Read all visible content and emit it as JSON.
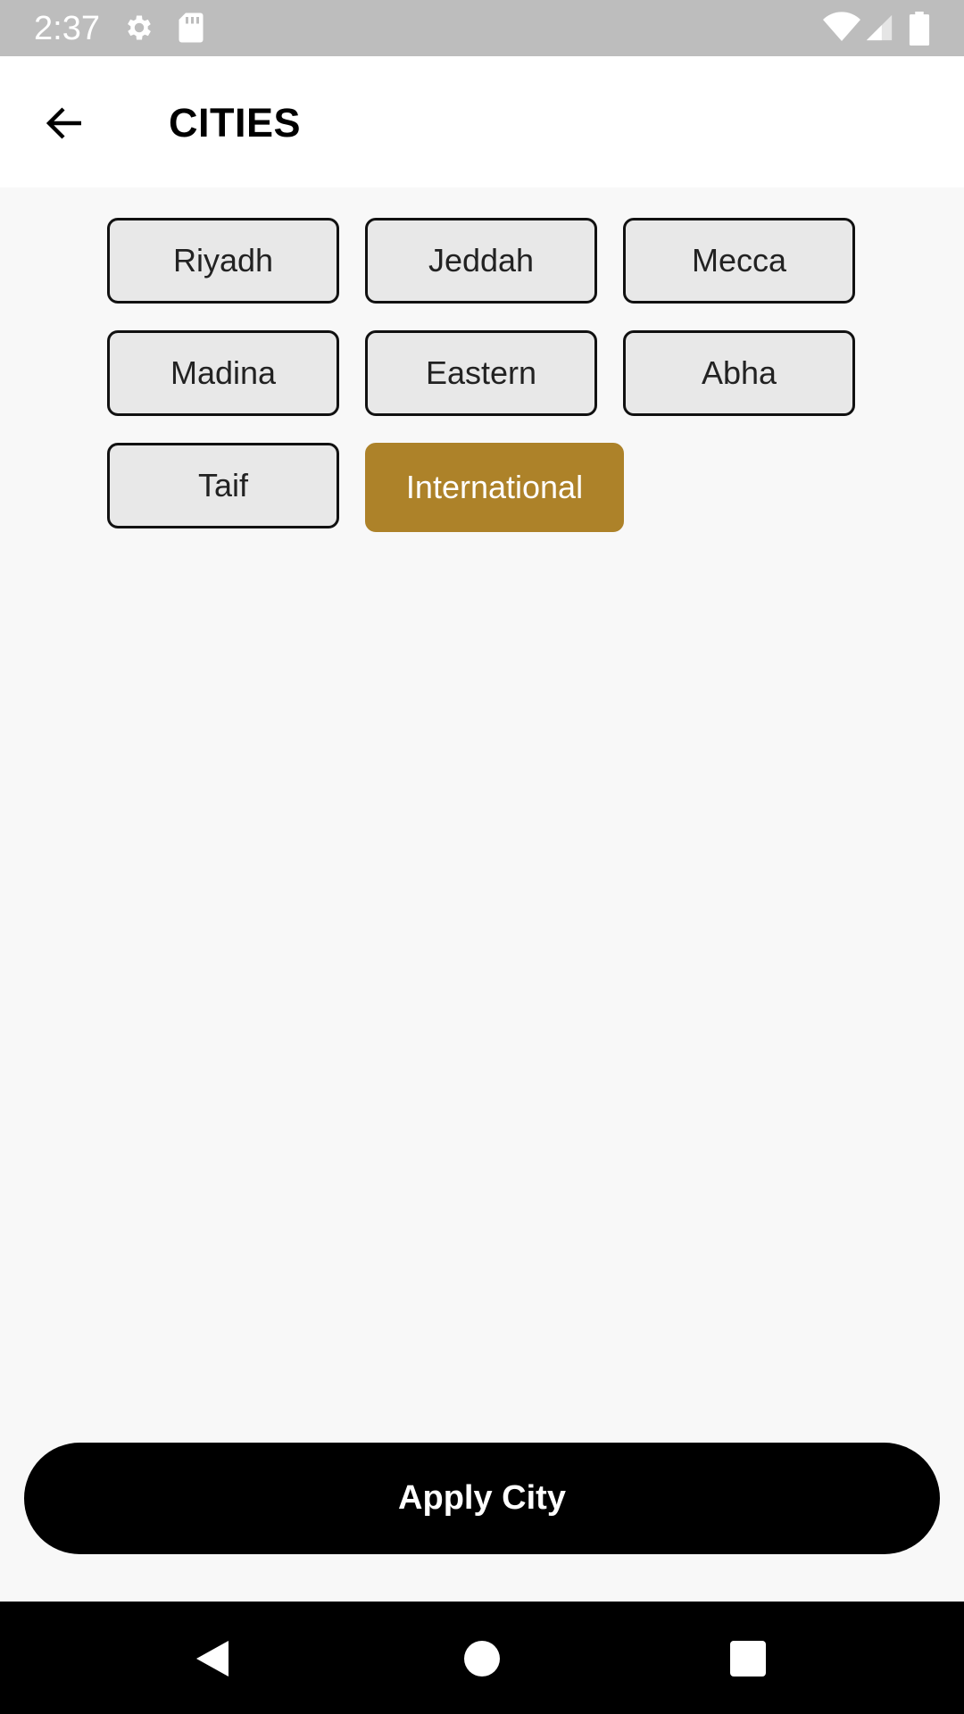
{
  "status_bar": {
    "time": "2:37",
    "icons": [
      "settings-icon",
      "sd-card-icon",
      "wifi-icon",
      "signal-icon",
      "battery-icon"
    ]
  },
  "header": {
    "title": "CITIES",
    "back_icon": "arrow-back-icon"
  },
  "cities": [
    {
      "label": "Riyadh",
      "selected": false
    },
    {
      "label": "Jeddah",
      "selected": false
    },
    {
      "label": "Mecca",
      "selected": false
    },
    {
      "label": "Madina",
      "selected": false
    },
    {
      "label": "Eastern",
      "selected": false
    },
    {
      "label": "Abha",
      "selected": false
    },
    {
      "label": "Taif",
      "selected": false
    },
    {
      "label": "International",
      "selected": true
    }
  ],
  "apply_button": {
    "label": "Apply City"
  },
  "colors": {
    "accent": "#ad8229",
    "chip_background": "#e8e8e8",
    "button_background": "#000000",
    "status_bar": "#bdbdbd"
  },
  "nav_bar": {
    "icons": [
      "back-triangle-icon",
      "home-circle-icon",
      "recents-square-icon"
    ]
  }
}
